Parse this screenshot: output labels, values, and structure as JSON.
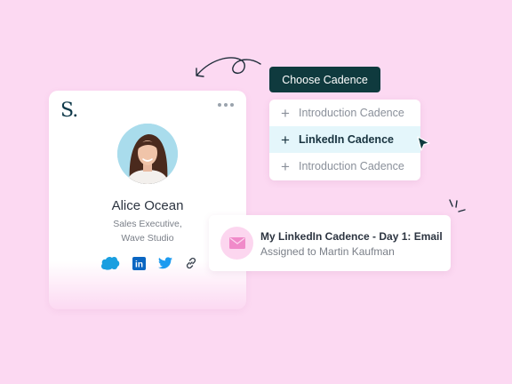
{
  "profile_card": {
    "logo": "S.",
    "more_icon": "more-horizontal-icon",
    "name": "Alice Ocean",
    "role": "Sales Executive,",
    "company": "Wave Studio",
    "socials": [
      "salesforce-icon",
      "linkedin-icon",
      "twitter-icon",
      "link-icon"
    ],
    "social_linkedin_text": "in"
  },
  "cadence": {
    "choose_label": "Choose Cadence",
    "options": [
      {
        "label": "Introduction Cadence",
        "selected": false
      },
      {
        "label": "LinkedIn Cadence",
        "selected": true
      },
      {
        "label": "Introduction Cadence",
        "selected": false
      }
    ]
  },
  "notification": {
    "icon": "mail-icon",
    "title": "My LinkedIn Cadence - Day 1: Email",
    "subtitle": "Assigned to Martin Kaufman"
  },
  "colors": {
    "background": "#fcd9f2",
    "primary_button": "#0f3a3e",
    "selected_row": "#e4f6fb",
    "mail_icon_bg": "#fcd6ef",
    "salesforce": "#1a9fe0",
    "linkedin": "#0a66c2",
    "twitter": "#1d9bf0"
  }
}
